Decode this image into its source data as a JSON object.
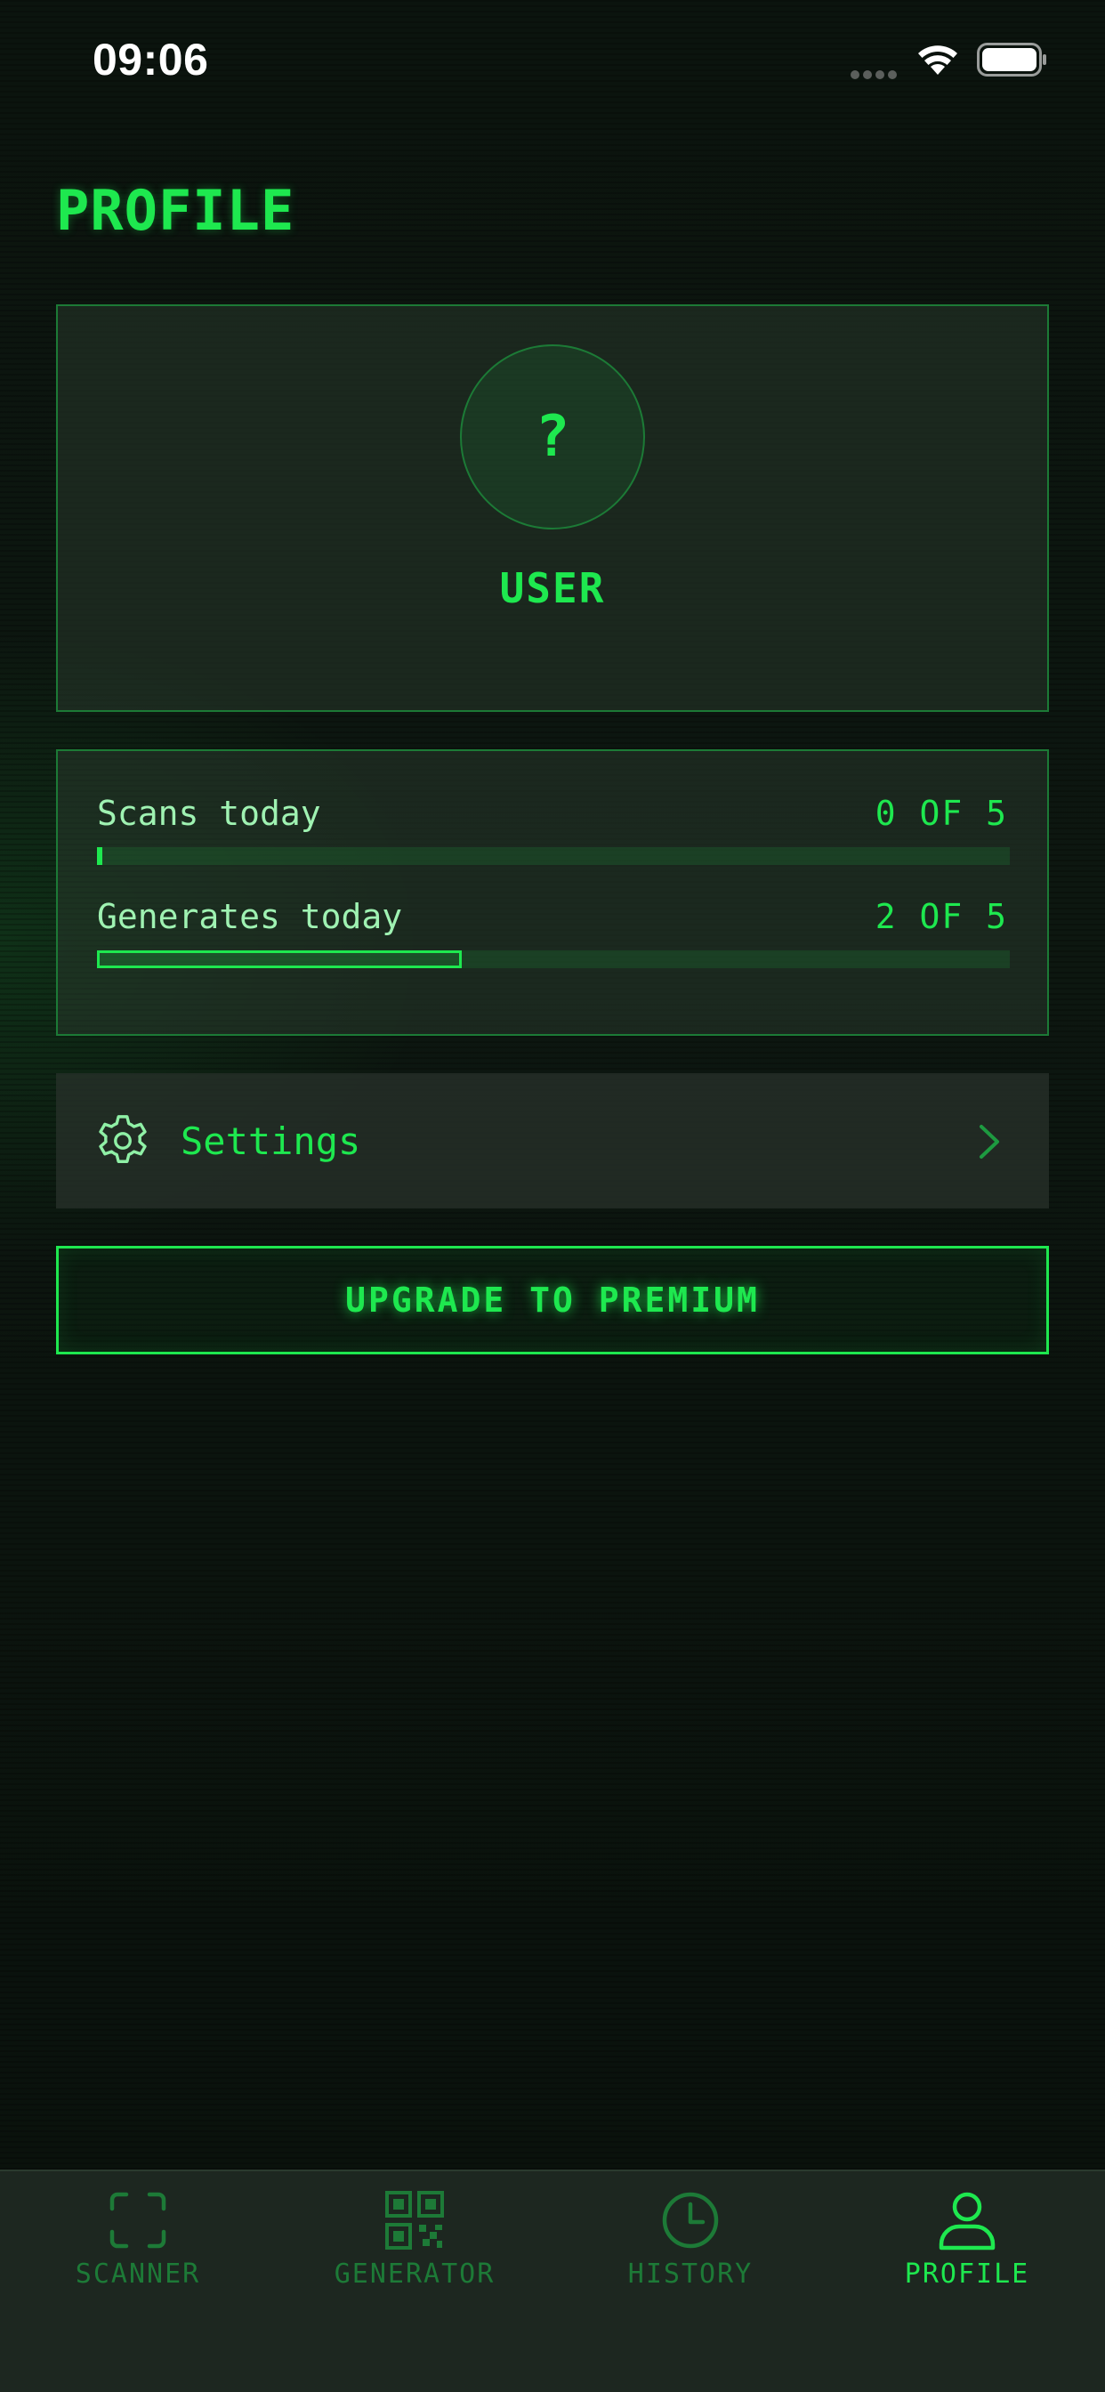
{
  "status_bar": {
    "time": "09:06"
  },
  "page": {
    "title": "PROFILE"
  },
  "profile": {
    "avatar_placeholder": "?",
    "username": "USER"
  },
  "usage": {
    "scans": {
      "label": "Scans today",
      "value_text": "0 OF 5",
      "used": 0,
      "limit": 5
    },
    "generates": {
      "label": "Generates today",
      "value_text": "2 OF 5",
      "used": 2,
      "limit": 5
    }
  },
  "settings": {
    "icon": "gear-icon",
    "label": "Settings",
    "chevron": "chevron-right-icon"
  },
  "upgrade": {
    "label": "UPGRADE TO PREMIUM"
  },
  "tabs": [
    {
      "label": "SCANNER",
      "icon": "scanner-frame-icon",
      "active": false
    },
    {
      "label": "GENERATOR",
      "icon": "qr-code-icon",
      "active": false
    },
    {
      "label": "HISTORY",
      "icon": "clock-icon",
      "active": false
    },
    {
      "label": "PROFILE",
      "icon": "person-icon",
      "active": true
    }
  ],
  "colors": {
    "accent": "#1ee84f",
    "accent_dim": "#1d7a37",
    "card_border": "#1c7a36",
    "background": "#0b140e",
    "tab_bar": "#1d2720"
  }
}
